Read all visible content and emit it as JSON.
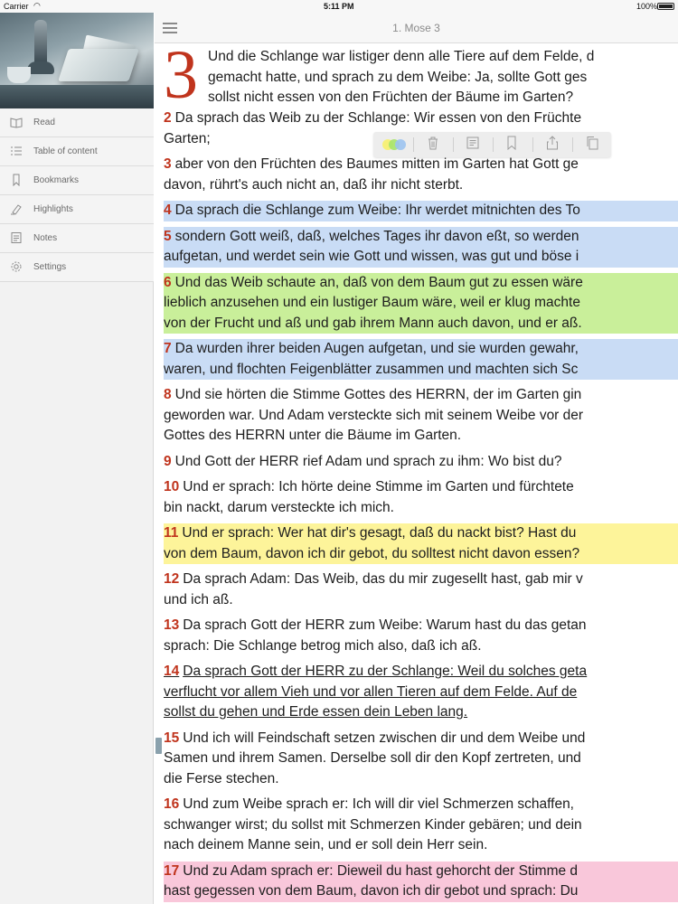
{
  "status_bar": {
    "carrier": "Carrier",
    "time": "5:11 PM",
    "battery": "100%"
  },
  "sidebar": {
    "items": [
      {
        "label": "Read",
        "icon": "book-icon"
      },
      {
        "label": "Table of content",
        "icon": "list-icon"
      },
      {
        "label": "Bookmarks",
        "icon": "bookmark-icon"
      },
      {
        "label": "Highlights",
        "icon": "highlighter-icon"
      },
      {
        "label": "Notes",
        "icon": "note-icon"
      },
      {
        "label": "Settings",
        "icon": "gear-icon"
      }
    ]
  },
  "navbar": {
    "title": "1. Mose 3"
  },
  "toolbar": {
    "highlight_colors": [
      "#f6f07a",
      "#a6e36b",
      "#9cc3ef"
    ],
    "icons": [
      "trash-icon",
      "note-icon",
      "bookmark-icon",
      "share-icon",
      "copy-icon"
    ]
  },
  "chapter": {
    "dropcap": "3",
    "verse1_lines": [
      "Und die Schlange war listiger denn alle Tiere auf dem Felde, d",
      "gemacht hatte, und sprach zu dem Weibe: Ja, sollte Gott ges",
      "sollst nicht essen von den Früchten der Bäume im Garten?"
    ],
    "verses": [
      {
        "num": "2",
        "lines": [
          "Da sprach das Weib zu der Schlange: Wir essen von den Früchte",
          "Garten;"
        ]
      },
      {
        "num": "3",
        "lines": [
          "aber von den Früchten des Baumes mitten im Garten hat Gott ge",
          "davon, rührt's auch nicht an, daß ihr nicht sterbt."
        ]
      },
      {
        "num": "4",
        "lines": [
          "Da sprach die Schlange zum Weibe: Ihr werdet mitnichten des To"
        ]
      },
      {
        "num": "5",
        "lines": [
          "sondern Gott weiß, daß, welches Tages ihr davon eßt, so werden",
          "aufgetan, und werdet sein wie Gott und wissen, was gut und böse i"
        ]
      },
      {
        "num": "6",
        "lines": [
          "Und das Weib schaute an, daß von dem Baum gut zu essen wäre",
          "lieblich anzusehen und ein lustiger Baum wäre, weil er klug machte",
          "von der Frucht und aß und gab ihrem Mann auch davon, und er aß."
        ]
      },
      {
        "num": "7",
        "lines": [
          "Da wurden ihrer beiden Augen aufgetan, und sie wurden gewahr,",
          "waren, und flochten Feigenblätter zusammen und machten sich Sc"
        ]
      },
      {
        "num": "8",
        "lines": [
          "Und sie hörten die Stimme Gottes des HERRN, der im Garten gin",
          "geworden war. Und Adam versteckte sich mit seinem Weibe vor der",
          "Gottes des HERRN unter die Bäume im Garten."
        ]
      },
      {
        "num": "9",
        "lines": [
          "Und Gott der HERR rief Adam und sprach zu ihm: Wo bist du?"
        ]
      },
      {
        "num": "10",
        "lines": [
          "Und er sprach: Ich hörte deine Stimme im Garten und fürchtete",
          "bin nackt, darum versteckte ich mich."
        ]
      },
      {
        "num": "11",
        "lines": [
          "Und er sprach: Wer hat dir's gesagt, daß du nackt bist? Hast du",
          "von dem Baum, davon ich dir gebot, du solltest nicht davon essen?"
        ]
      },
      {
        "num": "12",
        "lines": [
          "Da sprach Adam: Das Weib, das du mir zugesellt hast, gab mir v",
          "und ich aß."
        ]
      },
      {
        "num": "13",
        "lines": [
          "Da sprach Gott der HERR zum Weibe: Warum hast du das getan",
          "sprach: Die Schlange betrog mich also, daß ich aß."
        ]
      },
      {
        "num": "14",
        "lines": [
          "Da sprach Gott der HERR zu der Schlange: Weil du solches geta",
          "verflucht vor allem Vieh und vor allen Tieren auf dem Felde. Auf de",
          "sollst du gehen und Erde essen dein Leben lang."
        ]
      },
      {
        "num": "15",
        "lines": [
          "Und ich will Feindschaft setzen zwischen dir und dem Weibe und",
          "Samen und ihrem Samen. Derselbe soll dir den Kopf zertreten, und",
          "die Ferse stechen."
        ]
      },
      {
        "num": "16",
        "lines": [
          "Und zum Weibe sprach er: Ich will dir viel Schmerzen schaffen,",
          "schwanger wirst; du sollst mit Schmerzen Kinder gebären; und dein",
          "nach deinem Manne sein, und er soll dein Herr sein."
        ]
      },
      {
        "num": "17",
        "lines": [
          "Und zu Adam sprach er: Dieweil du hast gehorcht der Stimme d",
          "hast gegessen von dem Baum, davon ich dir gebot und sprach: Du"
        ]
      }
    ]
  }
}
